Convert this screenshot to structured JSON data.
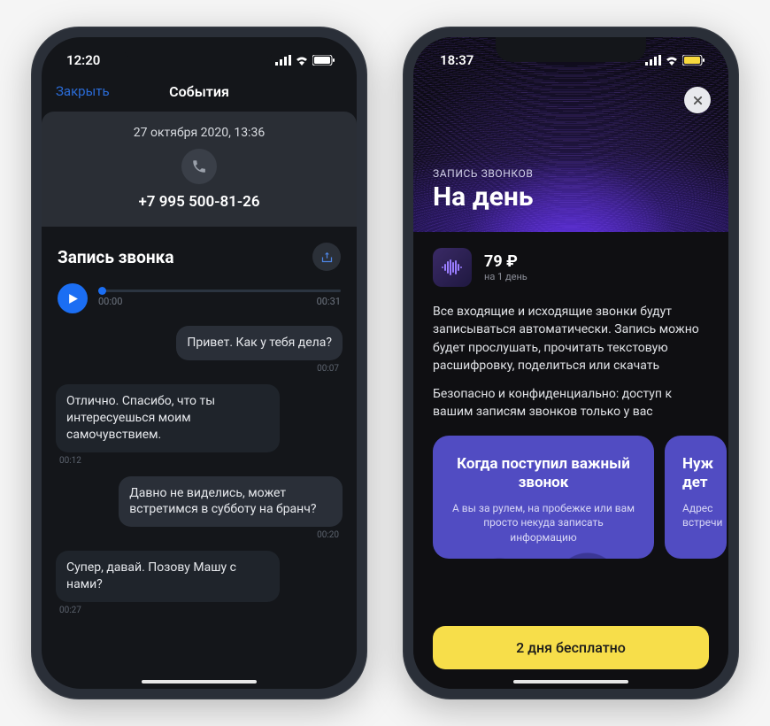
{
  "left": {
    "status": {
      "time": "12:20",
      "battery_color": "#ffffff"
    },
    "nav": {
      "close": "Закрыть",
      "title": "События"
    },
    "header": {
      "date": "27 октября 2020, 13:36",
      "phone": "+7 995 500-81-26"
    },
    "section": {
      "title": "Запись звонка"
    },
    "player": {
      "current": "00:00",
      "duration": "00:31"
    },
    "messages": [
      {
        "side": "right",
        "text": "Привет. Как у тебя дела?",
        "time": "00:07"
      },
      {
        "side": "left",
        "text": "Отлично. Спасибо, что ты интересуешься моим самочувствием.",
        "time": "00:12"
      },
      {
        "side": "right",
        "text": "Давно не виделись, может встретимся в субботу на бранч?",
        "time": "00:20"
      },
      {
        "side": "left",
        "text": "Супер, давай. Позову Машу с нами?",
        "time": "00:27"
      }
    ]
  },
  "right": {
    "status": {
      "time": "18:37",
      "battery_color": "#f7d93e"
    },
    "hero": {
      "eyebrow": "ЗАПИСЬ ЗВОНКОВ",
      "title": "На день"
    },
    "price": {
      "amount": "79 ₽",
      "sub": "на 1 день"
    },
    "desc1": "Все входящие и исходящие звонки будут записываться автоматически. Запись можно будет прослушать, прочитать текстовую расшифровку, поделиться или скачать",
    "desc2": "Безопасно и конфиденциально: доступ к вашим записям звонков только у вас",
    "feature1": {
      "title": "Когда поступил важный звонок",
      "sub": "А вы за рулем, на пробежке или вам просто некуда записать информацию"
    },
    "feature2": {
      "title_fragment": "Нуж",
      "line2_fragment": "дет",
      "sub_line1": "Адрес",
      "sub_line2": "встречи"
    },
    "cta": "2 дня бесплатно"
  }
}
